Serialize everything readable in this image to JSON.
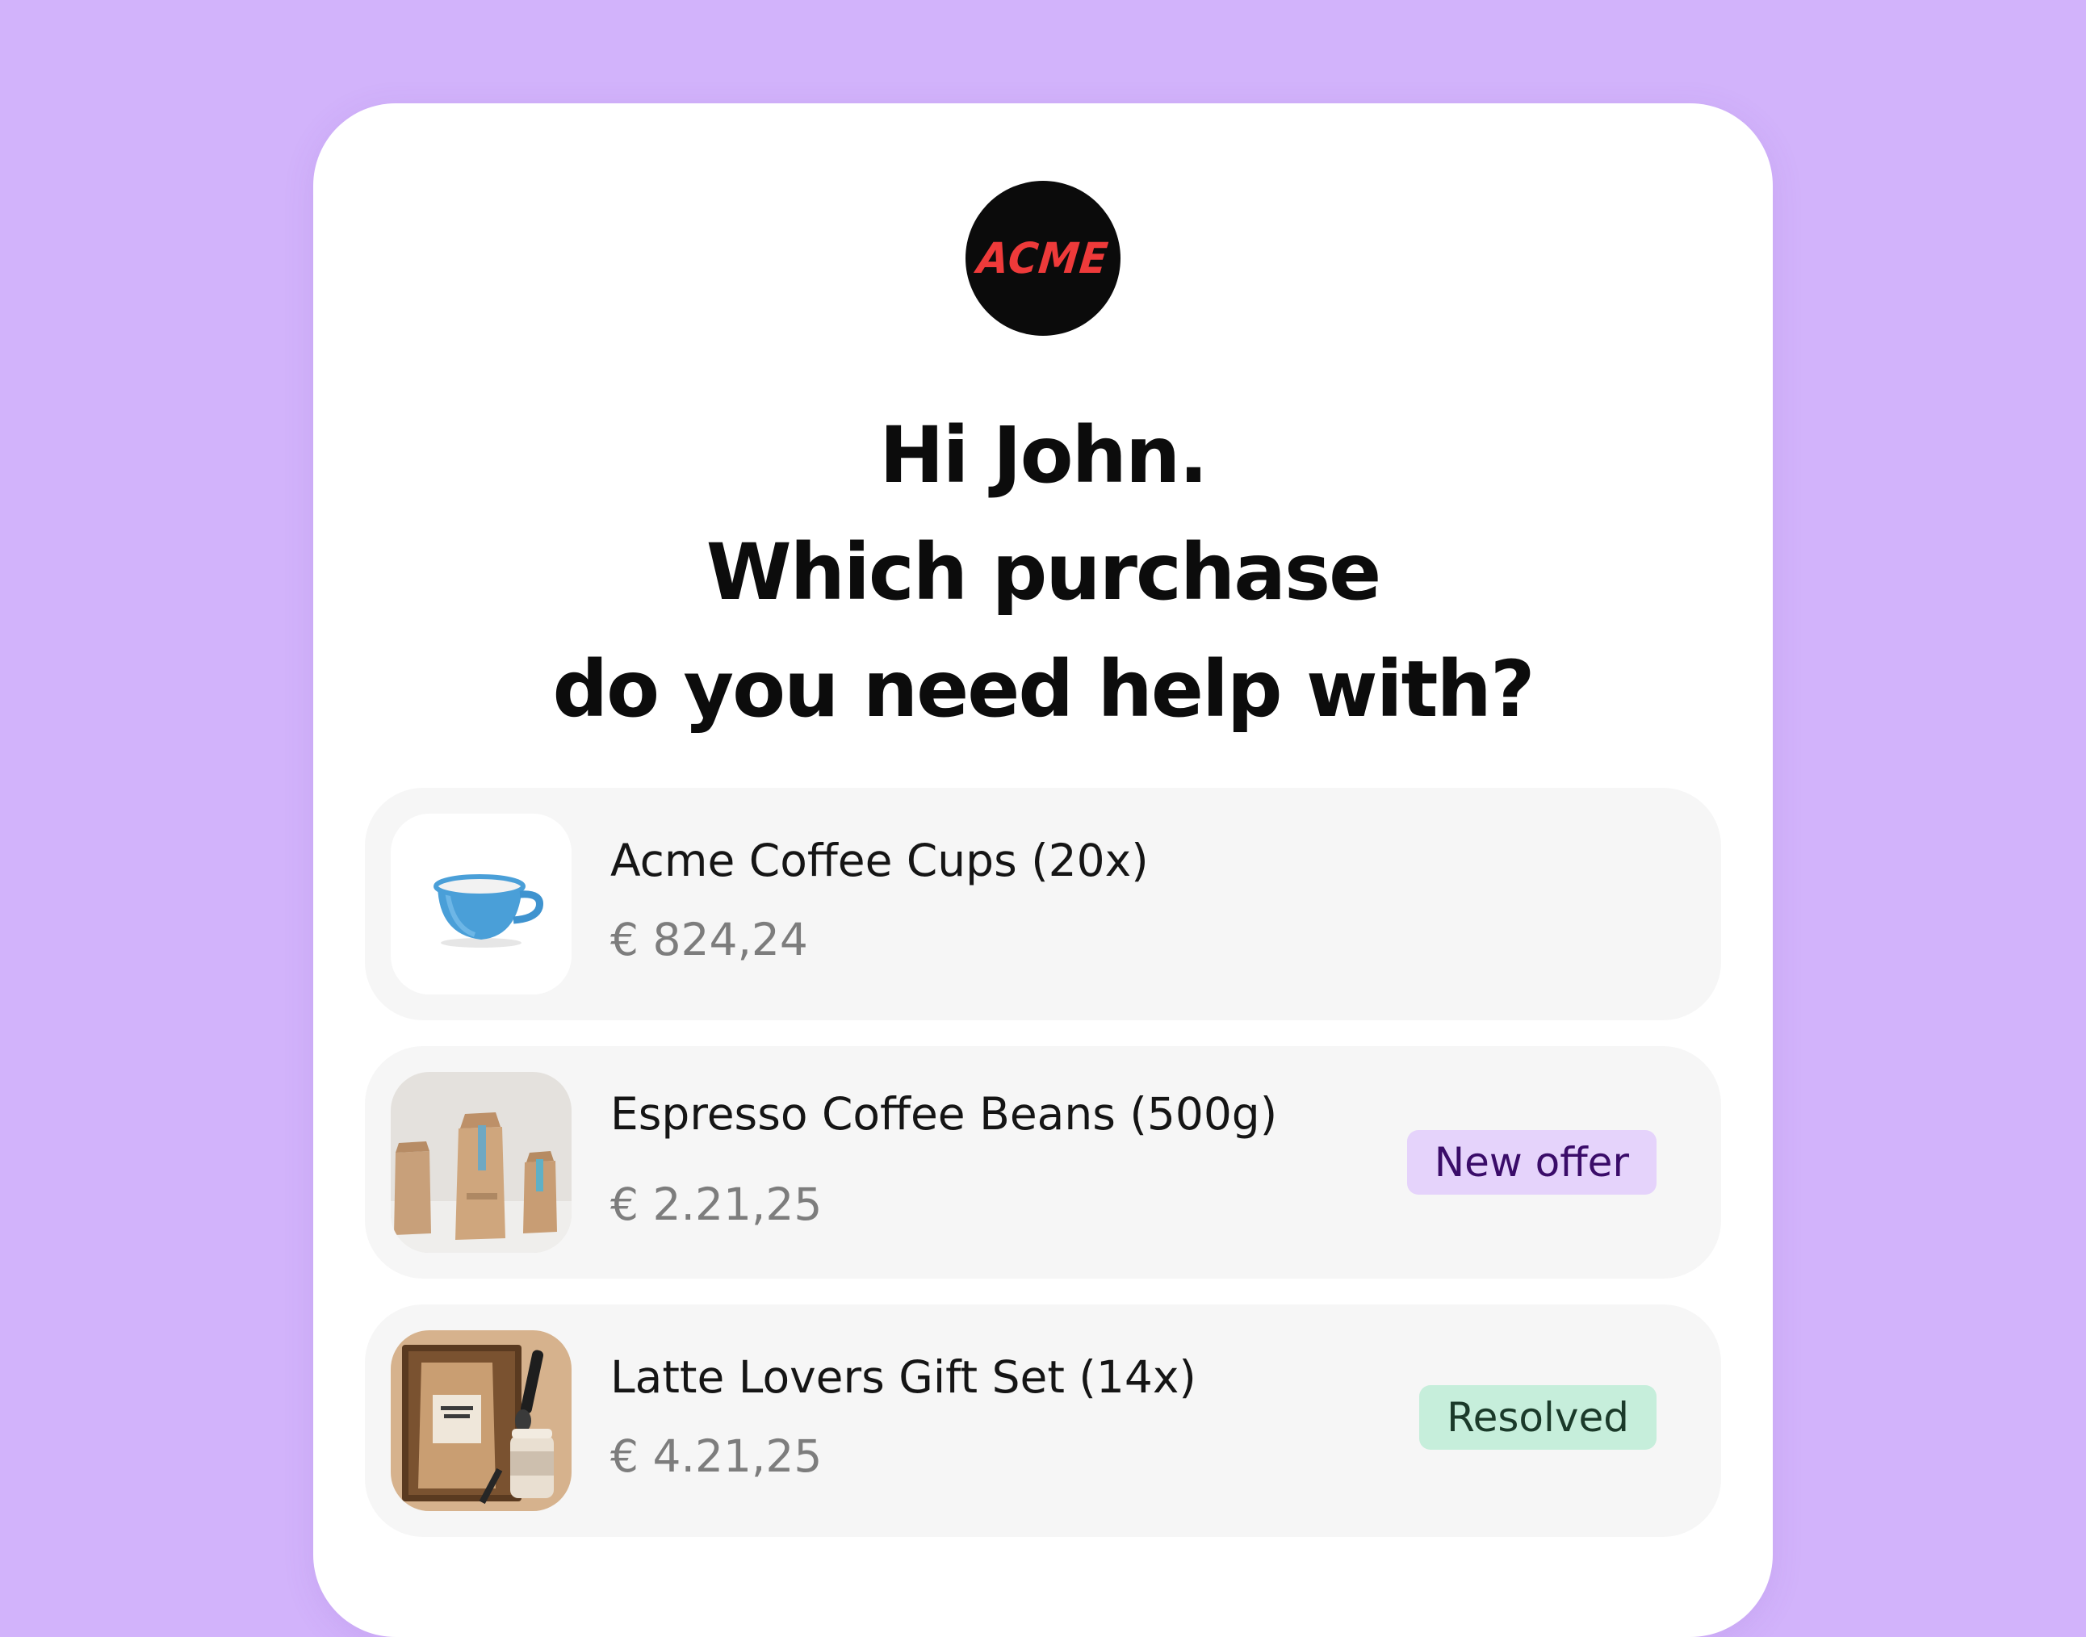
{
  "brand": {
    "logo_text": "ACME",
    "logo_bg": "#0b0b0b",
    "logo_color": "#ee3a3a"
  },
  "heading": {
    "line1": "Hi John.",
    "line2": "Which purchase",
    "line3": "do you need help with?"
  },
  "purchases": [
    {
      "title": "Acme Coffee Cups (20x)",
      "price": "€ 824,24",
      "icon": "coffee-cup-image",
      "badge": null
    },
    {
      "title": "Espresso Coffee Beans (500g)",
      "price": "€ 2.21,25",
      "icon": "coffee-bags-image",
      "badge": {
        "label": "New offer",
        "bg": "#e5d3fb",
        "color": "#3a0c69"
      }
    },
    {
      "title": "Latte Lovers Gift Set (14x)",
      "price": "€ 4.21,25",
      "icon": "gift-set-image",
      "badge": {
        "label": "Resolved",
        "bg": "#c6eedb",
        "color": "#1b3a2a"
      }
    }
  ],
  "colors": {
    "page_bg": "#d2b3fb",
    "card_bg": "#ffffff",
    "item_bg": "#f6f6f6"
  }
}
